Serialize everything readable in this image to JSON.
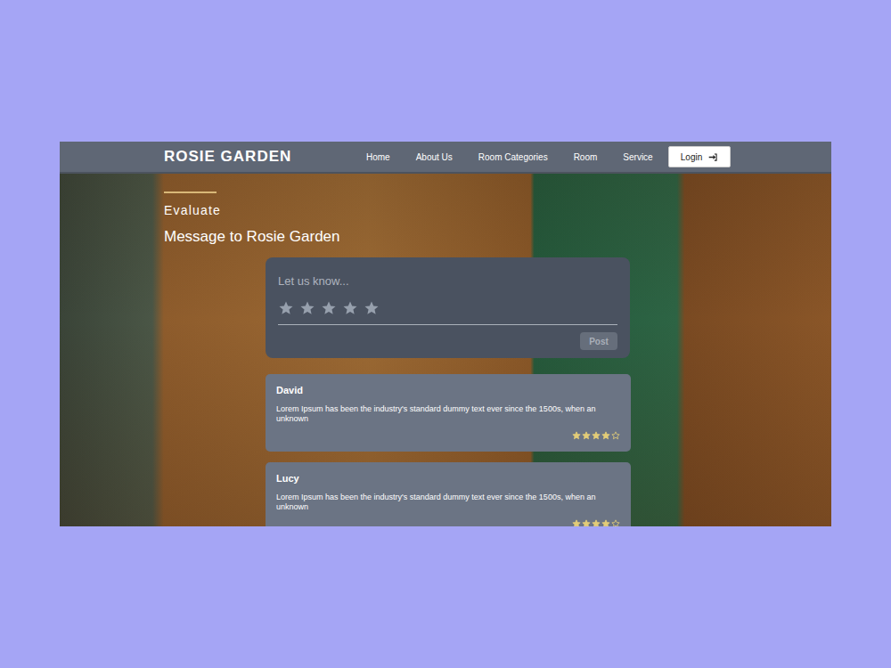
{
  "brand": "ROSIE GARDEN",
  "nav": {
    "items": [
      {
        "label": "Home"
      },
      {
        "label": "About Us"
      },
      {
        "label": "Room Categories"
      },
      {
        "label": "Room"
      },
      {
        "label": "Service"
      }
    ],
    "login": "Login"
  },
  "section": {
    "eyebrow": "Evaluate",
    "title": "Message to Rosie Garden"
  },
  "form": {
    "placeholder": "Let us know...",
    "stars": 0,
    "max_stars": 5,
    "button": "Post",
    "disabled": true
  },
  "reviews": [
    {
      "name": "David",
      "text": "Lorem Ipsum has been the industry's standard dummy text ever since the 1500s, when an unknown",
      "stars": 4
    },
    {
      "name": "Lucy",
      "text": "Lorem Ipsum has been the industry's standard dummy text ever since the 1500s, when an unknown",
      "stars": 4
    }
  ]
}
